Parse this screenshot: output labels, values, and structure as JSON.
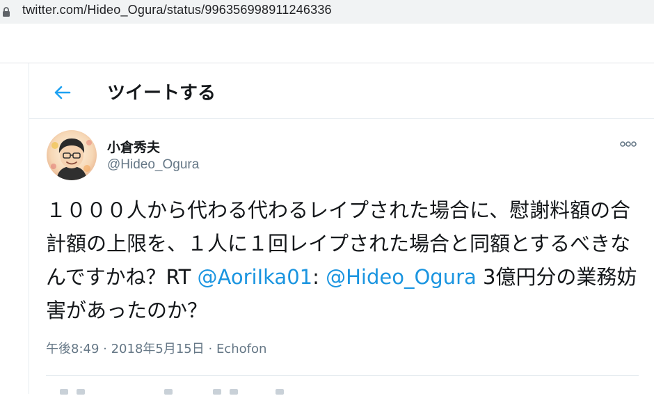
{
  "browser": {
    "url": "twitter.com/Hideo_Ogura/status/996356998911246336",
    "lock_icon": "lock-icon"
  },
  "header": {
    "back_icon": "arrow-left-icon",
    "title": "ツイートする",
    "accent_color": "#1da1f2"
  },
  "tweet": {
    "author": {
      "display_name": "小倉秀夫",
      "handle": "@Hideo_Ogura"
    },
    "more_icon": "more-dots-icon",
    "text_part1": "１０００人から代わる代わるレイプされた場合に、慰謝料額の合計額の上限を、１人に１回レイプされた場合と同額とするべきなんですかね？RT ",
    "mention1": "@AoriIka01",
    "text_part2": ": ",
    "mention2": "@Hideo_Ogura",
    "text_part3": " 3億円分の業務妨害があったのか？",
    "link_color": "#1b95e0",
    "meta": {
      "time": "午後8:49",
      "separator1": " · ",
      "date": "2018年5月15日",
      "separator2": " · ",
      "source": "Echofon"
    }
  }
}
